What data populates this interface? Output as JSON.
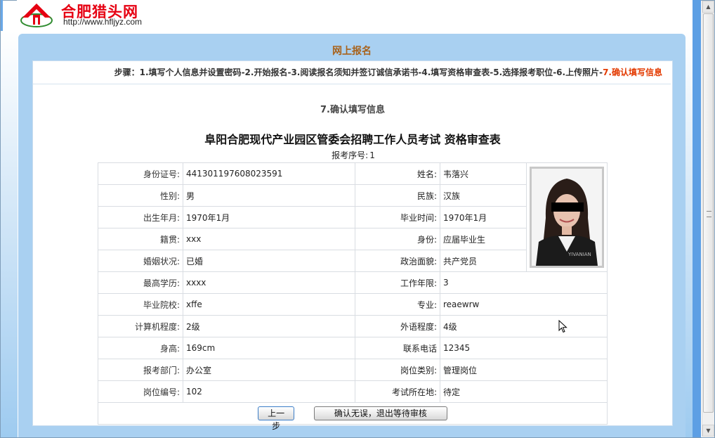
{
  "header": {
    "site_name": "合肥猎头网",
    "site_url": "http://www.hfljyz.com",
    "logo_icon": "red-roof-logo"
  },
  "panel": {
    "title": "网上报名"
  },
  "steps": {
    "prefix": "步骤：",
    "items": [
      "1.填写个人信息并设置密码",
      "2.开始报名",
      "3.阅读报名须知并签订诚信承诺书",
      "4.填写资格审查表",
      "5.选择报考职位",
      "6.上传照片",
      "7.确认填写信息"
    ],
    "separator": "-"
  },
  "step_heading": "7.确认填写信息",
  "form": {
    "title": "阜阳合肥现代产业园区管委会招聘工作人员考试 资格审查表",
    "serial_label": "报考序号:",
    "serial_value": "1",
    "rows": [
      {
        "l1": "身份证号:",
        "v1": "441301197608023591",
        "l2": "姓名:",
        "v2": "韦落兴"
      },
      {
        "l1": "性别:",
        "v1": "男",
        "l2": "民族:",
        "v2": "汉族"
      },
      {
        "l1": "出生年月:",
        "v1": "1970年1月",
        "l2": "毕业时间:",
        "v2": "1970年1月"
      },
      {
        "l1": "籍贯:",
        "v1": "xxx",
        "l2": "身份:",
        "v2": "应届毕业生"
      },
      {
        "l1": "婚姻状况:",
        "v1": "已婚",
        "l2": "政治面貌:",
        "v2": "共产党员"
      },
      {
        "l1": "最高学历:",
        "v1": "xxxx",
        "l2": "工作年限:",
        "v2": "3"
      },
      {
        "l1": "毕业院校:",
        "v1": "xffe",
        "l2": "专业:",
        "v2": "reaewrw"
      },
      {
        "l1": "计算机程度:",
        "v1": "2级",
        "l2": "外语程度:",
        "v2": "4级"
      },
      {
        "l1": "身高:",
        "v1": "169cm",
        "l2": "联系电话",
        "v2": "12345"
      },
      {
        "l1": "报考部门:",
        "v1": "办公室",
        "l2": "岗位类别:",
        "v2": "管理岗位"
      },
      {
        "l1": "岗位编号:",
        "v1": "102",
        "l2": "考试所在地:",
        "v2": "待定"
      }
    ],
    "photo_watermark": "YIVANIAN",
    "buttons": {
      "prev": "上一步",
      "confirm": "确认无误，退出等待审核"
    }
  },
  "colors": {
    "accent_orange": "#a8621b",
    "current_step": "#e33a00",
    "panel_blue": "#a9d0f1",
    "logo_red": "#e60012"
  }
}
